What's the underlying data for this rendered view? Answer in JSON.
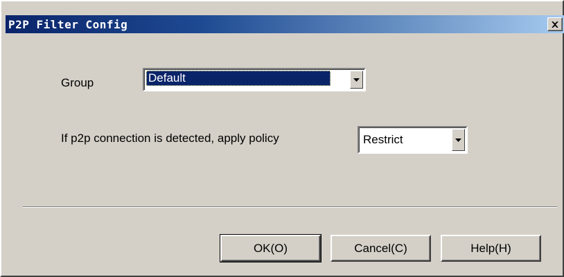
{
  "window": {
    "title": "P2P Filter Config",
    "close_label": "×"
  },
  "form": {
    "group_label": "Group",
    "group_value": "Default",
    "policy_label": "If p2p connection is detected, apply policy",
    "policy_value": "Restrict"
  },
  "buttons": {
    "ok": "OK(O)",
    "cancel": "Cancel(C)",
    "help": "Help(H)"
  },
  "colors": {
    "titlebar_start": "#0a246a",
    "titlebar_end": "#a6caf0",
    "face": "#d4d0c8",
    "selection": "#0a246a"
  },
  "icons": {
    "close": "close-icon",
    "dropdown": "chevron-down-icon"
  }
}
